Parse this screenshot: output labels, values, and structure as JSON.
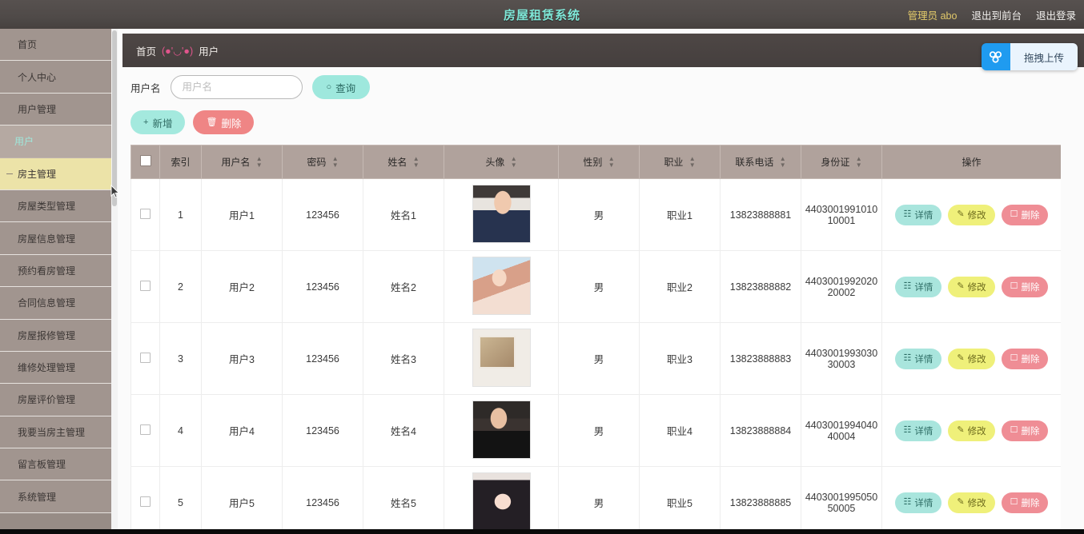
{
  "header": {
    "title": "房屋租赁系统",
    "user": "管理员 abo",
    "exit_front_label": "退出到前台",
    "logout_label": "退出登录"
  },
  "sidebar": {
    "items": [
      {
        "label": "首页",
        "state": "normal"
      },
      {
        "label": "个人中心",
        "state": "normal"
      },
      {
        "label": "用户管理",
        "state": "normal"
      },
      {
        "label": "用户",
        "state": "sub-active"
      },
      {
        "label": "房主管理",
        "state": "highlight"
      },
      {
        "label": "房屋类型管理",
        "state": "normal"
      },
      {
        "label": "房屋信息管理",
        "state": "normal"
      },
      {
        "label": "预约看房管理",
        "state": "normal"
      },
      {
        "label": "合同信息管理",
        "state": "normal"
      },
      {
        "label": "房屋报修管理",
        "state": "normal"
      },
      {
        "label": "维修处理管理",
        "state": "normal"
      },
      {
        "label": "房屋评价管理",
        "state": "normal"
      },
      {
        "label": "我要当房主管理",
        "state": "normal"
      },
      {
        "label": "留言板管理",
        "state": "normal"
      },
      {
        "label": "系统管理",
        "state": "normal"
      }
    ]
  },
  "breadcrumb": {
    "home": "首页",
    "separator": "(●'◡'●)",
    "current": "用户"
  },
  "upload": {
    "label": "拖拽上传",
    "icon": "cloud-upload-icon"
  },
  "search": {
    "label": "用户名",
    "value": "",
    "placeholder": "用户名",
    "query_label": "查询",
    "query_icon": "search-icon"
  },
  "toolbar": {
    "add_label": "新增",
    "add_icon": "plus-icon",
    "delete_label": "删除",
    "delete_icon": "trash-icon"
  },
  "table": {
    "columns": [
      {
        "label": "",
        "sortable": false,
        "key": "checkbox"
      },
      {
        "label": "索引",
        "sortable": false,
        "key": "index"
      },
      {
        "label": "用户名",
        "sortable": true,
        "key": "username"
      },
      {
        "label": "密码",
        "sortable": true,
        "key": "password"
      },
      {
        "label": "姓名",
        "sortable": true,
        "key": "name"
      },
      {
        "label": "头像",
        "sortable": true,
        "key": "avatar"
      },
      {
        "label": "性别",
        "sortable": true,
        "key": "gender"
      },
      {
        "label": "职业",
        "sortable": true,
        "key": "job"
      },
      {
        "label": "联系电话",
        "sortable": true,
        "key": "phone"
      },
      {
        "label": "身份证",
        "sortable": true,
        "key": "idcard"
      },
      {
        "label": "操作",
        "sortable": false,
        "key": "ops"
      }
    ],
    "rows": [
      {
        "index": "1",
        "username": "用户1",
        "password": "123456",
        "name": "姓名1",
        "avatar": "av1",
        "gender": "男",
        "job": "职业1",
        "phone": "13823888881",
        "idcard": "440300199101010001"
      },
      {
        "index": "2",
        "username": "用户2",
        "password": "123456",
        "name": "姓名2",
        "avatar": "av2",
        "gender": "男",
        "job": "职业2",
        "phone": "13823888882",
        "idcard": "440300199202020002"
      },
      {
        "index": "3",
        "username": "用户3",
        "password": "123456",
        "name": "姓名3",
        "avatar": "av3",
        "gender": "男",
        "job": "职业3",
        "phone": "13823888883",
        "idcard": "440300199303030003"
      },
      {
        "index": "4",
        "username": "用户4",
        "password": "123456",
        "name": "姓名4",
        "avatar": "av4",
        "gender": "男",
        "job": "职业4",
        "phone": "13823888884",
        "idcard": "440300199404040004"
      },
      {
        "index": "5",
        "username": "用户5",
        "password": "123456",
        "name": "姓名5",
        "avatar": "av5",
        "gender": "男",
        "job": "职业5",
        "phone": "13823888885",
        "idcard": "440300199505050005"
      }
    ],
    "row_ops": {
      "detail_label": "详情",
      "detail_icon": "file-icon",
      "edit_label": "修改",
      "edit_icon": "pencil-icon",
      "delete_label": "删除",
      "delete_icon": "trash-icon"
    }
  },
  "colors": {
    "header_bg": "#4f4a48",
    "header_title": "#7fe8d8",
    "header_user": "#e2c96a",
    "sidebar_bg": "#a1958f",
    "sidebar_active_text": "#9fe8dc",
    "sidebar_highlight_bg": "#ece3a8",
    "breadcrumb_bg": "#4a4342",
    "breadcrumb_sep": "#e0558c",
    "accent_teal": "#9ee8dd",
    "accent_red": "#ef8585",
    "accent_yellow": "#eff07a",
    "upload_blue": "#1f9bf0",
    "table_head_bg": "#b0a29c"
  }
}
